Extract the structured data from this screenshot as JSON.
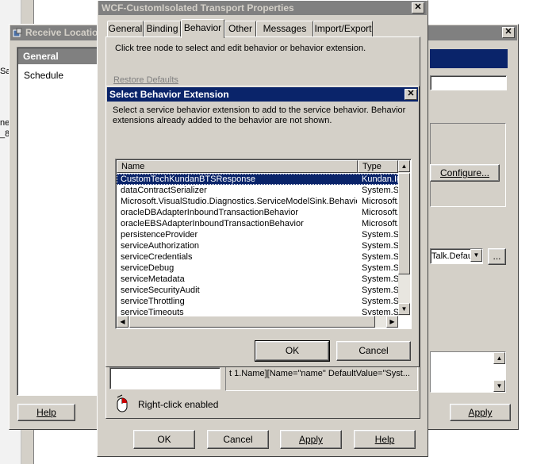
{
  "left_edge": {
    "text1": "Sa",
    "text2": "ne",
    "text3": "_8"
  },
  "receive_location": {
    "title": "Receive Location",
    "nav_header": "General",
    "nav_items": [
      "Schedule"
    ],
    "help_label": "Help"
  },
  "right_dialog": {
    "configure_label": "Configure...",
    "handler_value": "Talk.Defau",
    "browse_label": "...",
    "apply_label": "Apply"
  },
  "wcf_dialog": {
    "title": "WCF-CustomIsolated Transport Properties",
    "tabs": [
      "General",
      "Binding",
      "Behavior",
      "Other",
      "Messages",
      "Import/Export"
    ],
    "active_tab": "Behavior",
    "instruction": "Click tree node to select and edit behavior or behavior extension.",
    "restore_defaults": "Restore Defaults",
    "property_text": "t 1.Name][Name=\"name\" DefaultValue=\"Syst...",
    "right_click": "Right-click enabled",
    "buttons": {
      "ok": "OK",
      "cancel": "Cancel",
      "apply": "Apply",
      "help": "Help"
    }
  },
  "select_dialog": {
    "title": "Select Behavior Extension",
    "description": "Select a service behavior extension to add to the service behavior. Behavior extensions already added to the behavior are not shown.",
    "columns": {
      "name": "Name",
      "type": "Type"
    },
    "rows": [
      {
        "name": "CustomTechKundanBTSResponse",
        "type": "Kundan.In"
      },
      {
        "name": "dataContractSerializer",
        "type": "System.Se"
      },
      {
        "name": "Microsoft.VisualStudio.Diagnostics.ServiceModelSink.Behavior",
        "type": "Microsoft."
      },
      {
        "name": "oracleDBAdapterInboundTransactionBehavior",
        "type": "Microsoft."
      },
      {
        "name": "oracleEBSAdapterInboundTransactionBehavior",
        "type": "Microsoft."
      },
      {
        "name": "persistenceProvider",
        "type": "System.Se"
      },
      {
        "name": "serviceAuthorization",
        "type": "System.Se"
      },
      {
        "name": "serviceCredentials",
        "type": "System.Se"
      },
      {
        "name": "serviceDebug",
        "type": "System.Se"
      },
      {
        "name": "serviceMetadata",
        "type": "System.Se"
      },
      {
        "name": "serviceSecurityAudit",
        "type": "System.Se"
      },
      {
        "name": "serviceThrottling",
        "type": "System.Se"
      },
      {
        "name": "serviceTimeouts",
        "type": "System.Se"
      }
    ],
    "ok_label": "OK",
    "cancel_label": "Cancel"
  },
  "colors": {
    "title_active": "#0a246a",
    "title_inactive": "#808080",
    "face": "#d4d0c8",
    "selection": "#0a246a"
  }
}
